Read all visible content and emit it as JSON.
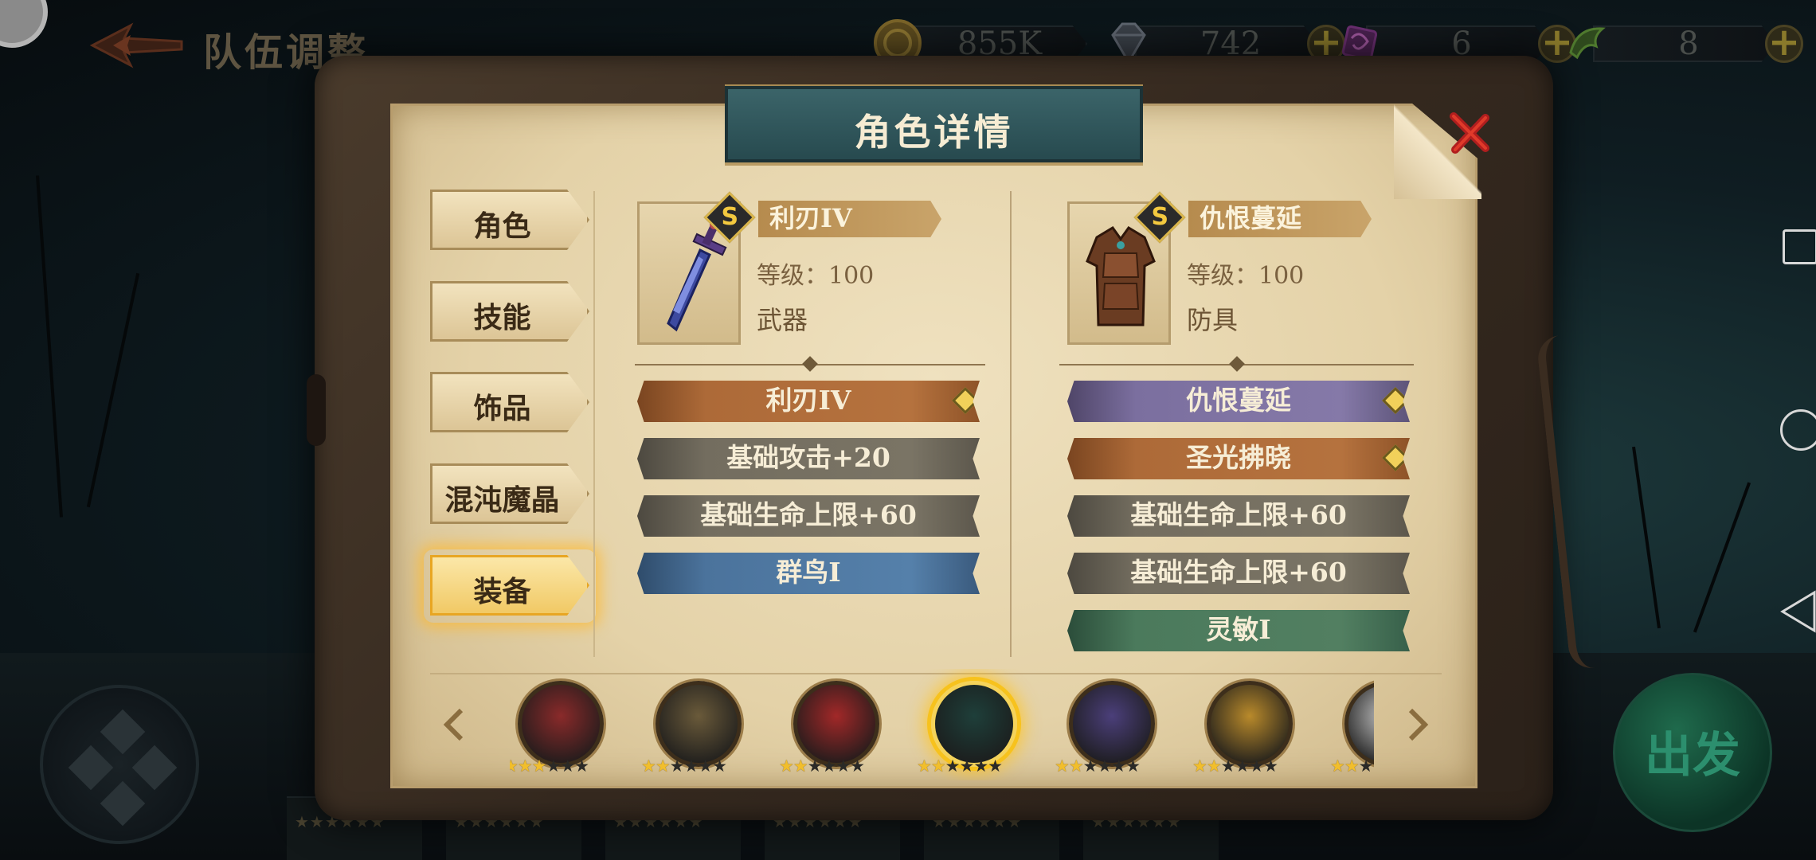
{
  "topbar": {
    "title": "队伍调整",
    "resources": [
      {
        "icon": "coin-icon",
        "value": "855K",
        "has_plus": false
      },
      {
        "icon": "diamond-icon",
        "value": "742",
        "has_plus": true
      },
      {
        "icon": "purple-crystal-icon",
        "value": "6",
        "has_plus": true
      },
      {
        "icon": "green-rune-icon",
        "value": "8",
        "has_plus": true
      }
    ],
    "plus_label": "+"
  },
  "panel": {
    "title": "角色详情",
    "tabs": [
      {
        "label": "角色",
        "active": false
      },
      {
        "label": "技能",
        "active": false
      },
      {
        "label": "饰品",
        "active": false
      },
      {
        "label": "混沌魔晶",
        "active": false
      },
      {
        "label": "装备",
        "active": true
      }
    ]
  },
  "equipment": [
    {
      "badge": "S",
      "name": "利刃IV",
      "level": "等级：100",
      "type": "武器",
      "icon": "sword-icon",
      "attributes": [
        {
          "text": "利刃IV",
          "color": "orange",
          "gem": true
        },
        {
          "text": "基础攻击+20",
          "color": "gray",
          "gem": false
        },
        {
          "text": "基础生命上限+60",
          "color": "gray",
          "gem": false
        },
        {
          "text": "群鸟I",
          "color": "blue",
          "gem": false
        }
      ]
    },
    {
      "badge": "S",
      "name": "仇恨蔓延",
      "level": "等级：100",
      "type": "防具",
      "icon": "armor-icon",
      "attributes": [
        {
          "text": "仇恨蔓延",
          "color": "purple",
          "gem": true
        },
        {
          "text": "圣光拂晓",
          "color": "orange",
          "gem": true
        },
        {
          "text": "基础生命上限+60",
          "color": "gray",
          "gem": false
        },
        {
          "text": "基础生命上限+60",
          "color": "gray",
          "gem": false
        },
        {
          "text": "灵敏I",
          "color": "green",
          "gem": false
        }
      ]
    }
  ],
  "heroes": [
    {
      "portrait": "hero-vampire-portrait",
      "stars": 3,
      "selected": false,
      "accent": "#8a2a2a"
    },
    {
      "portrait": "hero-blonde-warrior-portrait",
      "stars": 2,
      "selected": false,
      "accent": "#6a5a3a"
    },
    {
      "portrait": "hero-red-hood-portrait",
      "stars": 2,
      "selected": false,
      "accent": "#a22828"
    },
    {
      "portrait": "hero-dark-hair-portrait",
      "stars": 2,
      "selected": true,
      "accent": "#1e3f3a"
    },
    {
      "portrait": "hero-jester-portrait",
      "stars": 2,
      "selected": false,
      "accent": "#4b3f7a"
    },
    {
      "portrait": "hero-masked-portrait",
      "stars": 2,
      "selected": false,
      "accent": "#b98a2b"
    },
    {
      "portrait": "hero-white-portrait",
      "stars": 2,
      "selected": false,
      "accent": "#c8c8c8"
    }
  ],
  "go_button": "出发",
  "colors": {
    "orange": "#ad6a38",
    "gray": "#736d5f",
    "blue": "#4b739c",
    "purple": "#7b6f9f",
    "green": "#4b7a5c",
    "selected_glow": "#f7c21d"
  }
}
